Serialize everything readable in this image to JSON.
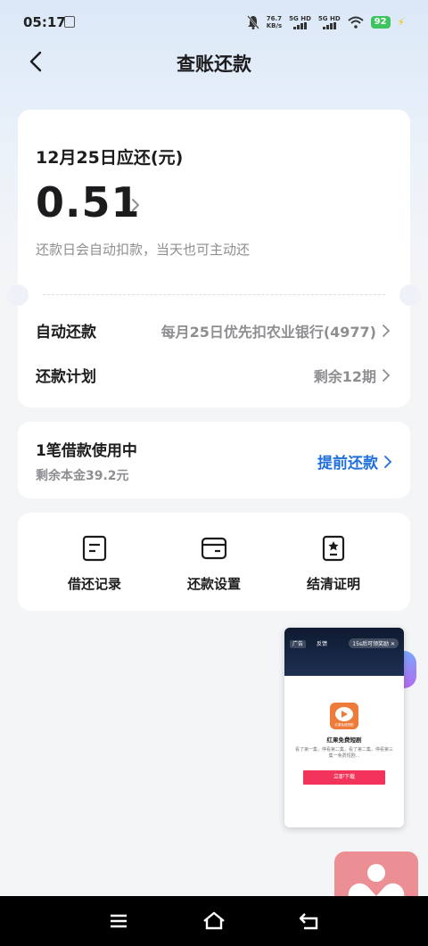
{
  "status": {
    "time": "05:17",
    "net_speed_value": "76.7",
    "net_speed_unit": "KB/s",
    "sim1": "5G HD",
    "sim2": "5G HD",
    "battery": "92"
  },
  "header": {
    "title": "查账还款"
  },
  "bill": {
    "due_label": "12月25日应还(元)",
    "amount": "0.51",
    "hint": "还款日会自动扣款，当天也可主动还"
  },
  "rows": {
    "auto_repay_label": "自动还款",
    "auto_repay_value": "每月25日优先扣农业银行(4977)",
    "plan_label": "还款计划",
    "plan_value": "剩余12期"
  },
  "loan": {
    "title": "1笔借款使用中",
    "remaining": "剩余本金39.2元",
    "prepay_label": "提前还款"
  },
  "actions": {
    "records": "借还记录",
    "settings": "还款设置",
    "certificate": "结清证明"
  },
  "ad": {
    "tag": "广告",
    "feedback": "反馈",
    "reward": "15s后可领奖励",
    "logo_text": "红果免费短剧",
    "app_name": "红果免费短剧",
    "desc": "看了第一集，停看第二集，看了第二集，停看第三集一免费短剧...",
    "button": "立即下载"
  }
}
